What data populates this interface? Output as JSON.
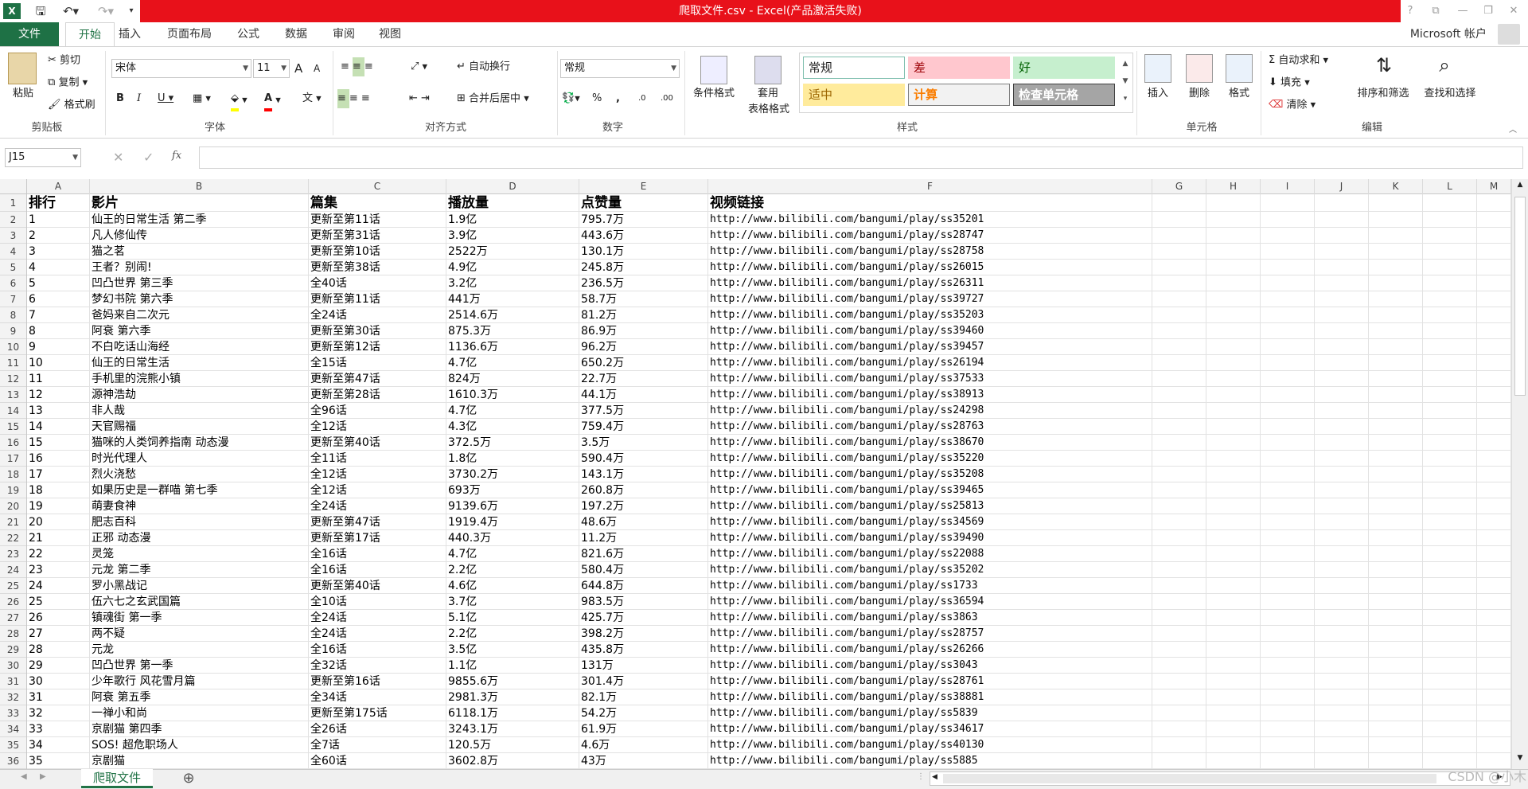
{
  "window": {
    "title": "爬取文件.csv -  Excel(产品激活失败)",
    "account": "Microsoft 帐户",
    "controls": [
      "?",
      "⧉",
      "—",
      "❐",
      "✕"
    ]
  },
  "tabs": [
    "文件",
    "开始",
    "插入",
    "页面布局",
    "公式",
    "数据",
    "审阅",
    "视图"
  ],
  "ribbon": {
    "clipboard": {
      "paste": "粘贴",
      "cut": "剪切",
      "copy": "复制",
      "format_painter": "格式刷",
      "label": "剪贴板"
    },
    "font": {
      "name": "宋体",
      "size": "11",
      "bold": "B",
      "italic": "I",
      "underline": "U",
      "label": "字体",
      "grow": "A",
      "shrink": "A",
      "color_a": "A"
    },
    "alignment": {
      "wrap": "自动换行",
      "merge": "合并后居中",
      "label": "对齐方式"
    },
    "number": {
      "format": "常规",
      "percent": "%",
      "comma": ",",
      "inc": ".00",
      "dec": ".0",
      "label": "数字"
    },
    "styles": {
      "conditional": "条件格式",
      "table_line1": "套用",
      "table_line2": "表格格式",
      "label": "样式",
      "cells": [
        {
          "text": "常规",
          "bg": "#ffffff",
          "fg": "#222222",
          "border": "#7fbfae"
        },
        {
          "text": "差",
          "bg": "#ffc7ce",
          "fg": "#9c0006",
          "border": "#ffc7ce"
        },
        {
          "text": "好",
          "bg": "#c6efce",
          "fg": "#006100",
          "border": "#c6efce"
        },
        {
          "text": "适中",
          "bg": "#ffeb9c",
          "fg": "#9c6500",
          "border": "#ffeb9c"
        },
        {
          "text": "计算",
          "bg": "#f2f2f2",
          "fg": "#fa7d00",
          "border": "#7f7f7f"
        },
        {
          "text": "检查单元格",
          "bg": "#a5a5a5",
          "fg": "#ffffff",
          "border": "#3f3f3f"
        }
      ]
    },
    "cells_grp": {
      "insert": "插入",
      "delete": "删除",
      "format": "格式",
      "label": "单元格"
    },
    "editing": {
      "autosum": "自动求和",
      "fill": "填充",
      "clear": "清除",
      "sort": "排序和筛选",
      "find": "查找和选择",
      "label": "编辑"
    }
  },
  "formula_bar": {
    "name_box": "J15",
    "fx": "fx",
    "value": ""
  },
  "columns": [
    "A",
    "B",
    "C",
    "D",
    "E",
    "F",
    "G",
    "H",
    "I",
    "J",
    "K",
    "L",
    "M"
  ],
  "header_row": [
    "排行",
    "影片",
    "篇集",
    "播放量",
    "点赞量",
    "视频链接"
  ],
  "rows": [
    [
      "1",
      "仙王的日常生活 第二季",
      "更新至第11话",
      "1.9亿",
      "795.7万",
      "http://www.bilibili.com/bangumi/play/ss35201"
    ],
    [
      "2",
      "凡人修仙传",
      "更新至第31话",
      "3.9亿",
      "443.6万",
      "http://www.bilibili.com/bangumi/play/ss28747"
    ],
    [
      "3",
      "猫之茗",
      "更新至第10话",
      "2522万",
      "130.1万",
      "http://www.bilibili.com/bangumi/play/ss28758"
    ],
    [
      "4",
      "王者？别闹!",
      "更新至第38话",
      "4.9亿",
      "245.8万",
      "http://www.bilibili.com/bangumi/play/ss26015"
    ],
    [
      "5",
      "凹凸世界 第三季",
      "全40话",
      "3.2亿",
      "236.5万",
      "http://www.bilibili.com/bangumi/play/ss26311"
    ],
    [
      "6",
      "梦幻书院 第六季",
      "更新至第11话",
      "441万",
      "58.7万",
      "http://www.bilibili.com/bangumi/play/ss39727"
    ],
    [
      "7",
      "爸妈来自二次元",
      "全24话",
      "2514.6万",
      "81.2万",
      "http://www.bilibili.com/bangumi/play/ss35203"
    ],
    [
      "8",
      "阿衰 第六季",
      "更新至第30话",
      "875.3万",
      "86.9万",
      "http://www.bilibili.com/bangumi/play/ss39460"
    ],
    [
      "9",
      "不白吃话山海经",
      "更新至第12话",
      "1136.6万",
      "96.2万",
      "http://www.bilibili.com/bangumi/play/ss39457"
    ],
    [
      "10",
      "仙王的日常生活",
      "全15话",
      "4.7亿",
      "650.2万",
      "http://www.bilibili.com/bangumi/play/ss26194"
    ],
    [
      "11",
      "手机里的浣熊小镇",
      "更新至第47话",
      "824万",
      "22.7万",
      "http://www.bilibili.com/bangumi/play/ss37533"
    ],
    [
      "12",
      "源神浩劫",
      "更新至第28话",
      "1610.3万",
      "44.1万",
      "http://www.bilibili.com/bangumi/play/ss38913"
    ],
    [
      "13",
      "非人哉",
      "全96话",
      "4.7亿",
      "377.5万",
      "http://www.bilibili.com/bangumi/play/ss24298"
    ],
    [
      "14",
      "天官赐福",
      "全12话",
      "4.3亿",
      "759.4万",
      "http://www.bilibili.com/bangumi/play/ss28763"
    ],
    [
      "15",
      "猫咪的人类饲养指南 动态漫",
      "更新至第40话",
      "372.5万",
      "3.5万",
      "http://www.bilibili.com/bangumi/play/ss38670"
    ],
    [
      "16",
      "时光代理人",
      "全11话",
      "1.8亿",
      "590.4万",
      "http://www.bilibili.com/bangumi/play/ss35220"
    ],
    [
      "17",
      "烈火浇愁",
      "全12话",
      "3730.2万",
      "143.1万",
      "http://www.bilibili.com/bangumi/play/ss35208"
    ],
    [
      "18",
      "如果历史是一群喵 第七季",
      "全12话",
      "693万",
      "260.8万",
      "http://www.bilibili.com/bangumi/play/ss39465"
    ],
    [
      "19",
      "萌妻食神",
      "全24话",
      "9139.6万",
      "197.2万",
      "http://www.bilibili.com/bangumi/play/ss25813"
    ],
    [
      "20",
      "肥志百科",
      "更新至第47话",
      "1919.4万",
      "48.6万",
      "http://www.bilibili.com/bangumi/play/ss34569"
    ],
    [
      "21",
      "正邪 动态漫",
      "更新至第17话",
      "440.3万",
      "11.2万",
      "http://www.bilibili.com/bangumi/play/ss39490"
    ],
    [
      "22",
      "灵笼",
      "全16话",
      "4.7亿",
      "821.6万",
      "http://www.bilibili.com/bangumi/play/ss22088"
    ],
    [
      "23",
      "元龙 第二季",
      "全16话",
      "2.2亿",
      "580.4万",
      "http://www.bilibili.com/bangumi/play/ss35202"
    ],
    [
      "24",
      "罗小黑战记",
      "更新至第40话",
      "4.6亿",
      "644.8万",
      "http://www.bilibili.com/bangumi/play/ss1733"
    ],
    [
      "25",
      "伍六七之玄武国篇",
      "全10话",
      "3.7亿",
      "983.5万",
      "http://www.bilibili.com/bangumi/play/ss36594"
    ],
    [
      "26",
      "镇魂街 第一季",
      "全24话",
      "5.1亿",
      "425.7万",
      "http://www.bilibili.com/bangumi/play/ss3863"
    ],
    [
      "27",
      "两不疑",
      "全24话",
      "2.2亿",
      "398.2万",
      "http://www.bilibili.com/bangumi/play/ss28757"
    ],
    [
      "28",
      "元龙",
      "全16话",
      "3.5亿",
      "435.8万",
      "http://www.bilibili.com/bangumi/play/ss26266"
    ],
    [
      "29",
      "凹凸世界 第一季",
      "全32话",
      "1.1亿",
      "131万",
      "http://www.bilibili.com/bangumi/play/ss3043"
    ],
    [
      "30",
      "少年歌行 风花雪月篇",
      "更新至第16话",
      "9855.6万",
      "301.4万",
      "http://www.bilibili.com/bangumi/play/ss28761"
    ],
    [
      "31",
      "阿衰 第五季",
      "全34话",
      "2981.3万",
      "82.1万",
      "http://www.bilibili.com/bangumi/play/ss38881"
    ],
    [
      "32",
      "一禅小和尚",
      "更新至第175话",
      "6118.1万",
      "54.2万",
      "http://www.bilibili.com/bangumi/play/ss5839"
    ],
    [
      "33",
      "京剧猫 第四季",
      "全26话",
      "3243.1万",
      "61.9万",
      "http://www.bilibili.com/bangumi/play/ss34617"
    ],
    [
      "34",
      "SOS! 超危职场人",
      "全7话",
      "120.5万",
      "4.6万",
      "http://www.bilibili.com/bangumi/play/ss40130"
    ],
    [
      "35",
      "京剧猫",
      "全60话",
      "3602.8万",
      "43万",
      "http://www.bilibili.com/bangumi/play/ss5885"
    ]
  ],
  "sheet_tab": "爬取文件",
  "add_sheet": "⊕",
  "watermark": "CSDN @小木"
}
